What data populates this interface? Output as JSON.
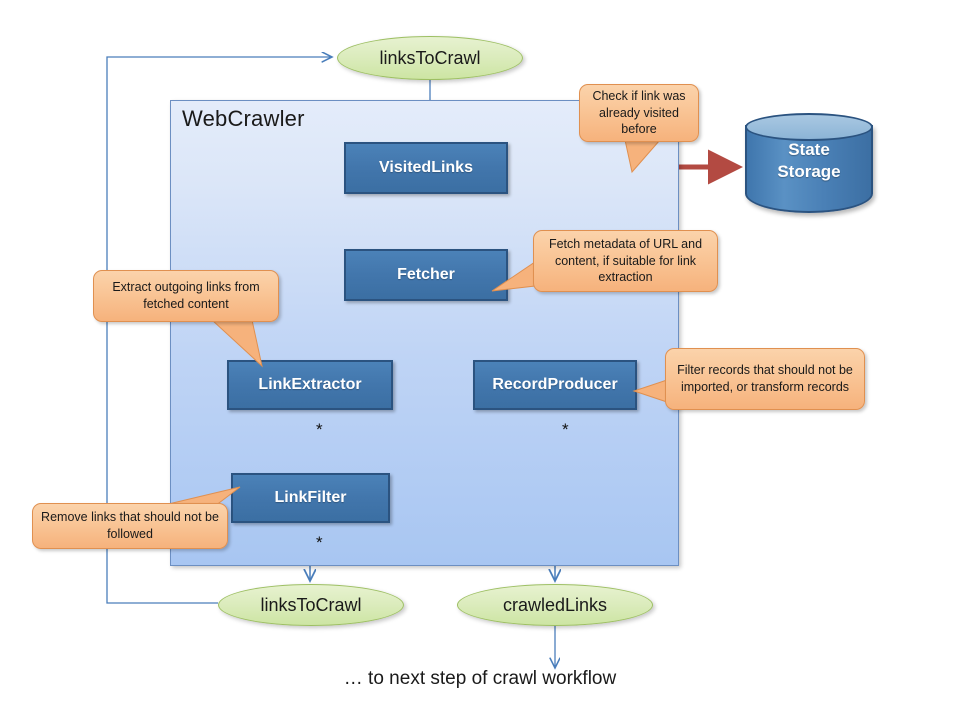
{
  "diagram": {
    "container": {
      "title": "WebCrawler"
    },
    "components": [
      {
        "id": "visitedlinks",
        "label": "VisitedLinks"
      },
      {
        "id": "fetcher",
        "label": "Fetcher"
      },
      {
        "id": "linkextractor",
        "label": "LinkExtractor"
      },
      {
        "id": "recordproducer",
        "label": "RecordProducer"
      },
      {
        "id": "linkfilter",
        "label": "LinkFilter"
      }
    ],
    "datastores": [
      {
        "id": "links-to-crawl-top",
        "label": "linksToCrawl"
      },
      {
        "id": "links-to-crawl-bottom",
        "label": "linksToCrawl"
      },
      {
        "id": "crawled-links",
        "label": "crawledLinks"
      }
    ],
    "external_store": {
      "line1": "State",
      "line2": "Storage"
    },
    "callouts": [
      {
        "id": "check-visited",
        "text": "Check if link was already visited before"
      },
      {
        "id": "fetch-metadata",
        "text": "Fetch metadata of URL and content, if suitable for link extraction"
      },
      {
        "id": "extract-links",
        "text": "Extract outgoing links from fetched content"
      },
      {
        "id": "filter-records",
        "text": "Filter records that should not be imported, or transform records"
      },
      {
        "id": "remove-links",
        "text": "Remove links that should not be followed"
      }
    ],
    "multiplicity": {
      "link_extractor_to_filter": "*",
      "record_producer_out": "*",
      "link_filter_out": "*"
    },
    "footer_note": "… to next step of crawl workflow",
    "colors": {
      "component_fill": "#4276ac",
      "component_border": "#2b5380",
      "container_fill": "#bfd4f5",
      "container_border": "#6c8fc2",
      "datastore_fill": "#dcecbe",
      "datastore_border": "#9dbf63",
      "callout_fill": "#f9c596",
      "callout_border": "#e09050",
      "flow_arrow": "#4a7ebb",
      "state_arrow": "#b34a42",
      "storage_fill": "#4a80b6"
    }
  }
}
